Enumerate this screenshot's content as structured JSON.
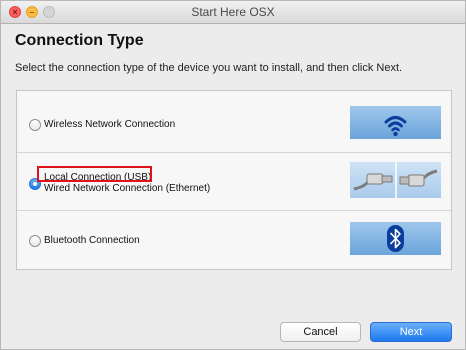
{
  "window": {
    "title": "Start Here OSX"
  },
  "page": {
    "heading": "Connection Type",
    "instruction": "Select the connection type of the device you want to install, and then click Next."
  },
  "options": [
    {
      "label": "Wireless Network Connection",
      "selected": false,
      "icon": "wifi-icon"
    },
    {
      "label": "Local Connection (USB)",
      "sublabel": "Wired Network Connection (Ethernet)",
      "selected": true,
      "icon": "usb-cable-icon",
      "highlighted": true,
      "highlight_color": "#e0121b"
    },
    {
      "label": "Bluetooth Connection",
      "selected": false,
      "icon": "bluetooth-icon"
    }
  ],
  "buttons": {
    "cancel": "Cancel",
    "next": "Next"
  },
  "colors": {
    "accent": "#1c79f0",
    "highlight": "#e0121b",
    "icon_tile": "#6aa4da"
  }
}
